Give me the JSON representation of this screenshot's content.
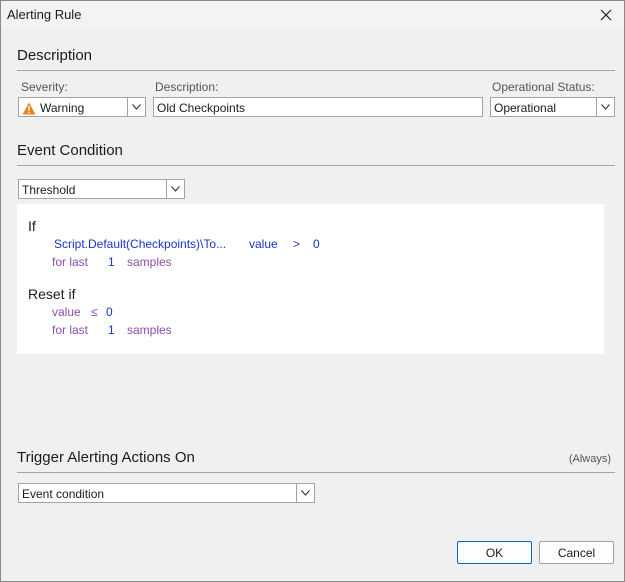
{
  "window": {
    "title": "Alerting Rule"
  },
  "description": {
    "section_title": "Description",
    "severity": {
      "label": "Severity:",
      "value": "Warning",
      "icon": "warning-icon",
      "icon_color": "#e8861c"
    },
    "description_field": {
      "label": "Description:",
      "value": "Old Checkpoints"
    },
    "operational_status": {
      "label": "Operational Status:",
      "value": "Operational"
    }
  },
  "event_condition": {
    "section_title": "Event Condition",
    "type": "Threshold",
    "if_label": "If",
    "condition": {
      "metric": "Script.Default(Checkpoints)\\To...",
      "field": "value",
      "operator": ">",
      "threshold": "0"
    },
    "if_window": {
      "prefix": "for last",
      "count": "1",
      "unit": "samples"
    },
    "reset_label": "Reset if",
    "reset_condition": {
      "field": "value",
      "operator": "≤",
      "threshold": "0"
    },
    "reset_window": {
      "prefix": "for last",
      "count": "1",
      "unit": "samples"
    }
  },
  "trigger": {
    "section_title": "Trigger Alerting Actions On",
    "hint": "(Always)",
    "value": "Event condition"
  },
  "buttons": {
    "ok": "OK",
    "cancel": "Cancel"
  },
  "colors": {
    "link_blue": "#1a33c9",
    "param_purple": "#8a4fa8",
    "ok_border": "#0067c0"
  }
}
